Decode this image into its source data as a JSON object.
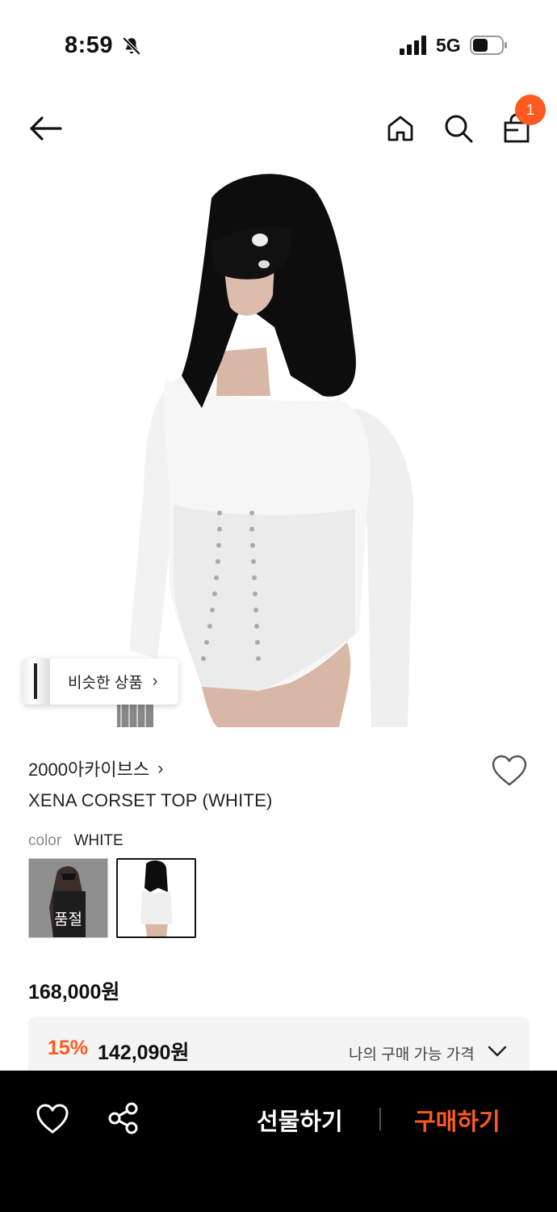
{
  "status_bar": {
    "time": "8:59",
    "network": "5G"
  },
  "nav": {
    "cart_badge": "1"
  },
  "product": {
    "similar_label": "비슷한 상품",
    "brand": "2000아카이브스",
    "title": "XENA CORSET TOP (WHITE)",
    "color_key": "color",
    "color_value": "WHITE",
    "soldout_label": "품절",
    "price": "168,000원",
    "discount_rate": "15%",
    "discount_price": "142,090원",
    "discount_note": "나의 구매 가능 가격"
  },
  "bottom_bar": {
    "gift_label": "선물하기",
    "buy_label": "구매하기"
  },
  "colors": {
    "accent": "#ff5a1f",
    "bottom_bar_bg": "#000000",
    "discount_bg": "#f4f4f4"
  },
  "icons": [
    "bell-off-icon",
    "signal-icon",
    "battery-icon",
    "back-arrow-icon",
    "home-icon",
    "search-icon",
    "shopping-bag-icon",
    "heart-icon",
    "share-icon",
    "chevron-down-icon"
  ]
}
